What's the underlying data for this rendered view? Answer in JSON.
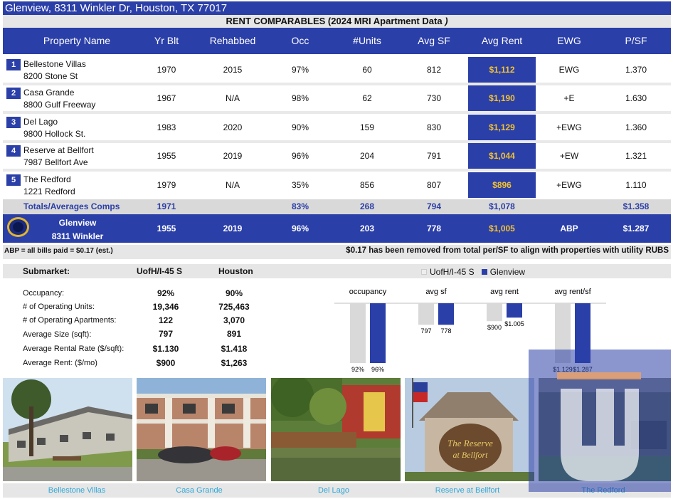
{
  "header": {
    "title": "Glenview, 8311 Winkler Dr, Houston, TX 77017",
    "subtitle_main": "RENT COMPARABLES  (2024 MRI Apartment Data",
    "subtitle_end": ")"
  },
  "columns": [
    "Property Name",
    "Yr Blt",
    "Rehabbed",
    "Occ",
    "#Units",
    "Avg SF",
    "Avg Rent",
    "EWG",
    "P/SF"
  ],
  "rows": [
    {
      "num": "1",
      "name": "Bellestone Villas",
      "addr": "8200 Stone St",
      "yr": "1970",
      "rehab": "2015",
      "occ": "97%",
      "units": "60",
      "sf": "812",
      "rent": "$1,112",
      "ewg": "EWG",
      "psf": "1.370"
    },
    {
      "num": "2",
      "name": "Casa Grande",
      "addr": "8800 Gulf Freeway",
      "yr": "1967",
      "rehab": "N/A",
      "occ": "98%",
      "units": "62",
      "sf": "730",
      "rent": "$1,190",
      "ewg": "+E",
      "psf": "1.630"
    },
    {
      "num": "3",
      "name": "Del Lago",
      "addr": "9800 Hollock St.",
      "yr": "1983",
      "rehab": "2020",
      "occ": "90%",
      "units": "159",
      "sf": "830",
      "rent": "$1,129",
      "ewg": "+EWG",
      "psf": "1.360"
    },
    {
      "num": "4",
      "name": "Reserve at Bellfort",
      "addr": "7987 Bellfort Ave",
      "yr": "1955",
      "rehab": "2019",
      "occ": "96%",
      "units": "204",
      "sf": "791",
      "rent": "$1,044",
      "ewg": "+EW",
      "psf": "1.321"
    },
    {
      "num": "5",
      "name": "The Redford",
      "addr": "1221 Redford",
      "yr": "1979",
      "rehab": "N/A",
      "occ": "35%",
      "units": "856",
      "sf": "807",
      "rent": "$896",
      "ewg": "+EWG",
      "psf": "1.110"
    }
  ],
  "totals": {
    "label": "Totals/Averages Comps",
    "yr": "1971",
    "occ": "83%",
    "units": "268",
    "sf": "794",
    "rent": "$1,078",
    "psf": "$1.358"
  },
  "subject": {
    "name": "Glenview",
    "addr": "8311 Winkler",
    "yr": "1955",
    "rehab": "2019",
    "occ": "96%",
    "units": "203",
    "sf": "778",
    "rent": "$1,005",
    "ewg": "ABP",
    "psf": "$1.287"
  },
  "notes": {
    "left": "ABP = all bills paid = $0.17 (est.)",
    "right": "$0.17 has been removed from total per/SF to align with properties with utility RUBS"
  },
  "submarket": {
    "label": "Submarket:",
    "col1": "UofH/I-45 S",
    "col2": "Houston",
    "rows": [
      {
        "label": "Occupancy:",
        "a": "92%",
        "b": "90%"
      },
      {
        "label": "# of Operating Units:",
        "a": "19,346",
        "b": "725,463"
      },
      {
        "label": "# of Operating Apartments:",
        "a": "122",
        "b": "3,070"
      },
      {
        "label": "Average Size (sqft):",
        "a": "797",
        "b": "891"
      },
      {
        "label": "Average Rental Rate ($/sqft):",
        "a": "$1.130",
        "b": "$1.418"
      },
      {
        "label": "Average Rent: ($/mo)",
        "a": "$900",
        "b": "$1,263"
      }
    ]
  },
  "chart_data": {
    "type": "bar",
    "categories": [
      "occupancy",
      "avg sf",
      "avg rent",
      "avg rent/sf"
    ],
    "series": [
      {
        "name": "UofH/I-45 S",
        "color": "#d9d9d9",
        "labels": [
          "92%",
          "797",
          "$900",
          "$1.129"
        ],
        "heights": [
          1.0,
          0.36,
          0.3,
          1.0
        ]
      },
      {
        "name": "Glenview",
        "color": "#2b3fa8",
        "labels": [
          "96%",
          "778",
          "$1.005",
          "$1.287"
        ],
        "heights": [
          1.0,
          0.36,
          0.24,
          1.0
        ]
      }
    ]
  },
  "photos": {
    "captions": [
      "Bellestone Villas",
      "Casa Grande",
      "Del Lago",
      "Reserve at Bellfort",
      "The Redford"
    ],
    "sign_text_1": "The Reserve",
    "sign_text_2": "at Bellfort"
  },
  "colors": {
    "primary": "#2b3fa8",
    "rent_text": "#f2c230",
    "caption": "#2fa7d8"
  }
}
